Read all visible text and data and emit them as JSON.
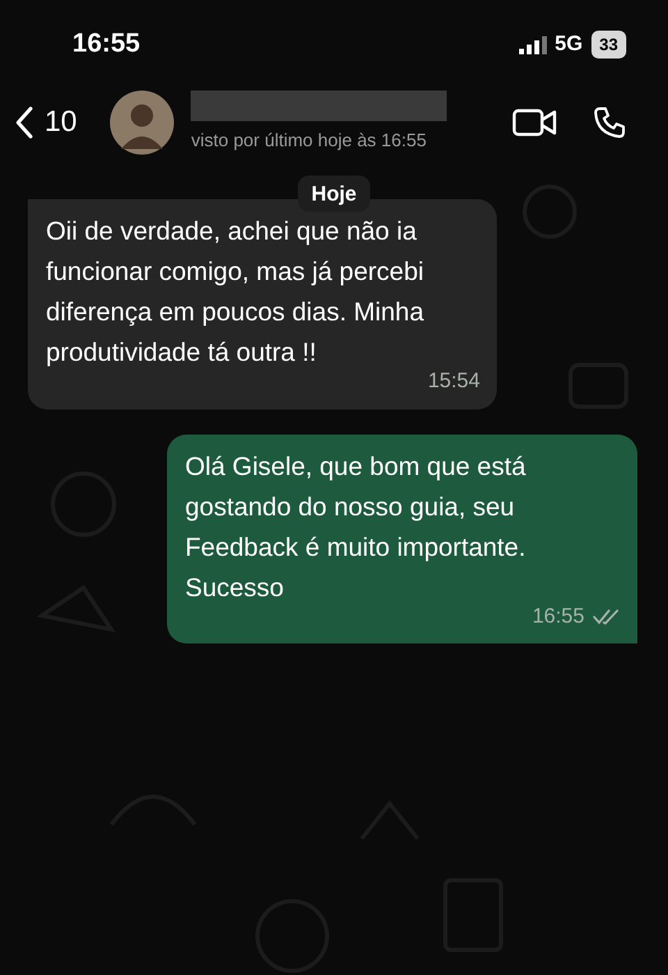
{
  "status_bar": {
    "time": "16:55",
    "network": "5G",
    "battery": "33"
  },
  "header": {
    "back_count": "10",
    "last_seen": "visto por último hoje às 16:55"
  },
  "date_chip": "Hoje",
  "messages": [
    {
      "kind": "incoming",
      "text": "Oii de verdade, achei que não ia funcionar comigo, mas já percebi diferença em poucos dias. Minha produtividade tá outra !!",
      "time": "15:54"
    },
    {
      "kind": "outgoing",
      "text": "Olá Gisele, que bom que está gostando do nosso guia, seu Feedback é muito importante. Sucesso",
      "time": "16:55"
    }
  ]
}
